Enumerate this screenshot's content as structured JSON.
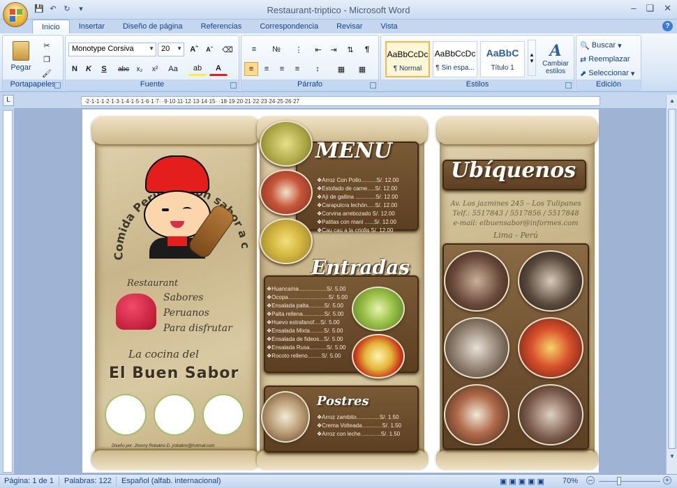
{
  "window": {
    "title": "Restaurant-triptico - Microsoft Word"
  },
  "tabs": [
    "Inicio",
    "Insertar",
    "Diseño de página",
    "Referencias",
    "Correspondencia",
    "Revisar",
    "Vista"
  ],
  "ribbon": {
    "paste_label": "Pegar",
    "groups": {
      "portapapeles": "Portapapeles",
      "fuente": "Fuente",
      "parrafo": "Párrafo",
      "estilos": "Estilos",
      "edicion": "Edición"
    },
    "font_name": "Monotype Corsiva",
    "font_size": "20",
    "styles": [
      {
        "sample": "AaBbCcDc",
        "name": "¶ Normal"
      },
      {
        "sample": "AaBbCcDc",
        "name": "¶ Sin espa..."
      },
      {
        "sample": "AaBbC",
        "name": "Título 1"
      }
    ],
    "change_styles": "Cambiar estilos",
    "find": "Buscar",
    "replace": "Reemplazar",
    "select": "Seleccionar"
  },
  "ruler": {
    "ticks": "·2·1·1·1·2·1·3·1·4·1·5·1·6·1·7·  ·9·10·11·12·13·14·15·  ·18·19·20·21·22·23·24·25·26·27"
  },
  "panel1": {
    "arc_text": "Comida Peruana con sabor a casa",
    "restaurant": "Restaurant",
    "tagline1": "Sabores",
    "tagline2": "Peruanos",
    "tagline3": "Para disfrutar",
    "la_cocina": "La cocina del",
    "name": "El Buen Sabor",
    "credit": "Diseño por: Jhonny Robalino D. jrobalino@hotmail.com"
  },
  "panel2": {
    "menu_title": "MENU",
    "menu_items": [
      "Arroz Con Pollo..........S/. 12.00",
      "Estofado de carne.....S/. 12.00",
      "Ají de gallina .............S/. 12.00",
      "Carapulcra lechón.....S/. 12.00",
      "Corvina arrebozado S/. 12.00",
      "Patitas con mani ......S/. 12.00",
      "Cau cau a la criolla S/. 12.00"
    ],
    "entradas_title": "Entradas",
    "entradas_items": [
      "Huancaína..................S/. 5.00",
      "Ocopa..........................S/. 5.00",
      "Ensalada palta..........S/. 5.00",
      "Palta rellena..............S/. 5.00",
      "Huevo estrafanof....S/. 5.00",
      "Ensalada Mixta.........S/. 5.00",
      "Ensalada de fideos...S/. 5.00",
      "Ensalada Rusa...........S/. 5.00",
      "Rocoto relleno.........S/. 5.00"
    ],
    "postres_title": "Postres",
    "postres_items": [
      "Arroz zambito...............S/. 1.50",
      "Crema Volteada.............S/. 1.50",
      "Arroz con leche.............S/. 1.50"
    ]
  },
  "panel3": {
    "title": "Ubíquenos",
    "address": "Av. Los jazmines 245 – Los Tulipanes",
    "phones": "Telf.: 5517843 / 5517856 / 5517848",
    "email": "e-mail: elbuensabor@informes.com",
    "city": "Lima - Perú"
  },
  "status": {
    "page": "Página: 1 de 1",
    "words": "Palabras: 122",
    "language": "Español (alfab. internacional)",
    "zoom": "70%"
  }
}
